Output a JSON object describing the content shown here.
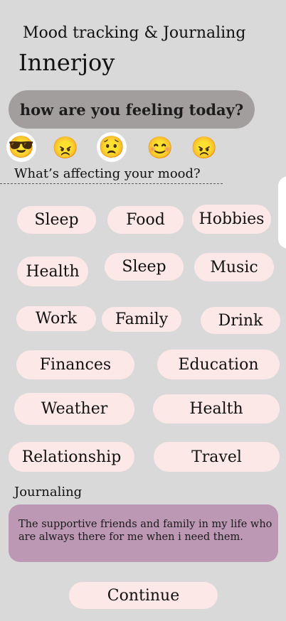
{
  "header": {
    "subtitle": "Mood tracking & Journaling",
    "title": "Innerjoy"
  },
  "question": "how are you feeling today?",
  "moods": [
    {
      "icon": "cool-face-emoji-icon",
      "glyph": "😎",
      "selected": true
    },
    {
      "icon": "angry-face-emoji-icon",
      "glyph": "😠",
      "selected": false
    },
    {
      "icon": "sad-face-emoji-icon",
      "glyph": "😟",
      "selected": true
    },
    {
      "icon": "happy-face-emoji-icon",
      "glyph": "😊",
      "selected": false
    },
    {
      "icon": "angry-face-emoji-icon-2",
      "glyph": "😠",
      "selected": false
    }
  ],
  "affecting_label": "What’s affecting your mood?",
  "chips": [
    {
      "label": "Sleep"
    },
    {
      "label": "Food"
    },
    {
      "label": "Hobbies"
    },
    {
      "label": "Health"
    },
    {
      "label": "Sleep"
    },
    {
      "label": "Music"
    },
    {
      "label": "Work"
    },
    {
      "label": "Family"
    },
    {
      "label": "Drink"
    },
    {
      "label": "Finances"
    },
    {
      "label": "Education"
    },
    {
      "label": "Weather"
    },
    {
      "label": "Health"
    },
    {
      "label": "Relationship"
    },
    {
      "label": "Travel"
    }
  ],
  "journal": {
    "label": "Journaling",
    "text": "The supportive  friends and family in my life who are always there for me when i need them."
  },
  "continue_label": "Continue"
}
